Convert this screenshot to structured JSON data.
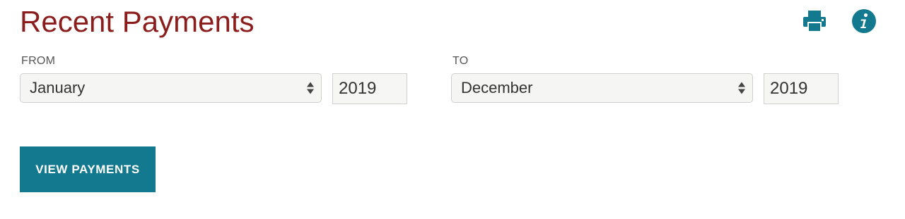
{
  "page": {
    "title": "Recent Payments"
  },
  "toolbar": {
    "print_icon": "printer-icon",
    "info_icon": "info-icon"
  },
  "from": {
    "label": "FROM",
    "month": "January",
    "year": "2019"
  },
  "to": {
    "label": "TO",
    "month": "December",
    "year": "2019"
  },
  "actions": {
    "view_label": "VIEW PAYMENTS"
  },
  "colors": {
    "title": "#8b1d1d",
    "accent": "#12798e",
    "input_bg": "#f5f5f4",
    "border": "#cfcfcf"
  }
}
